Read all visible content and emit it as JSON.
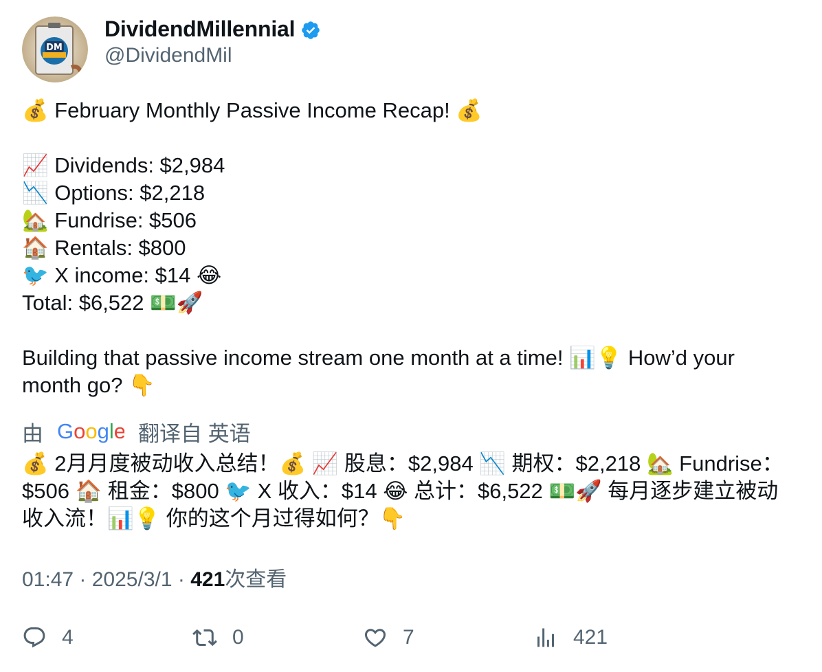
{
  "author": {
    "display_name": "DividendMillennial",
    "handle": "@DividendMil",
    "avatar_text": "DM",
    "verified_color": "#1d9bf0"
  },
  "tweet": {
    "line1": "💰 February Monthly Passive Income Recap! 💰",
    "line2": "📈 Dividends: $2,984",
    "line3": "📉 Options: $2,218",
    "line4": "🏡 Fundrise: $506",
    "line5": "🏠 Rentals: $800",
    "line6": "🐦 X income: $14 😂",
    "line7": "Total: $6,522 💵🚀",
    "line8": "Building that passive income stream one month at a time! 📊💡 How’d your month go? 👇"
  },
  "translation": {
    "prefix": "由",
    "suffix": "翻译自 英语",
    "google_logo": "Google",
    "text": "💰 2月月度被动收入总结！💰 📈 股息：$2,984 📉 期权：$2,218 🏡 Fundrise：$506 🏠 租金：$800 🐦 X 收入：$14 😂 总计：$6,522 💵🚀 每月逐步建立被动收入流！📊💡 你的这个月过得如何？👇"
  },
  "meta": {
    "time": "01:47",
    "date": "2025/3/1",
    "separator": " · ",
    "views_count": "421",
    "views_label": "次查看"
  },
  "actions": {
    "replies": "4",
    "reposts": "0",
    "likes": "7",
    "views": "421"
  }
}
